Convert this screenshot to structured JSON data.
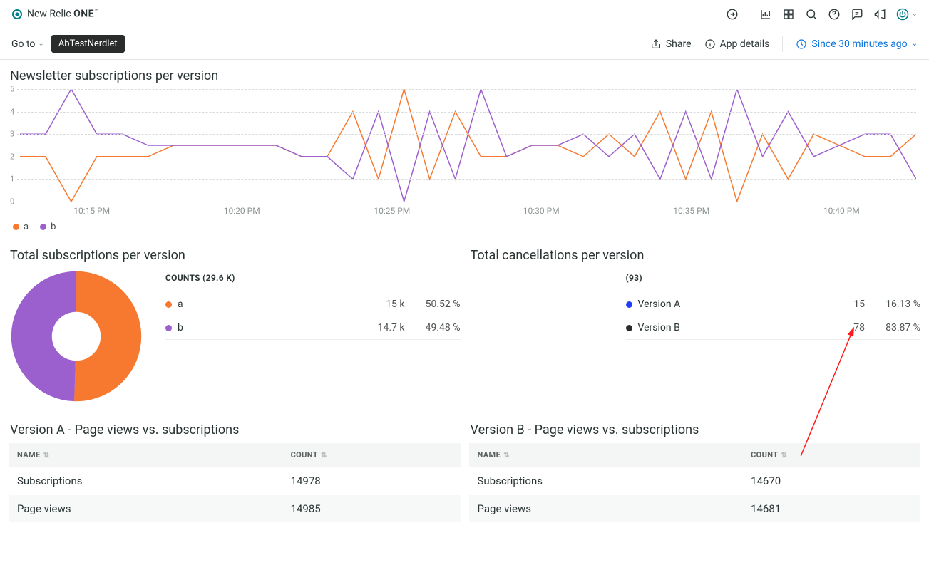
{
  "brand": {
    "name_prefix": "New Relic ",
    "name_suffix": "ONE",
    "tm": "™"
  },
  "topbar_icons": [
    "goto-icon",
    "chart-icon",
    "apps-icon",
    "search-icon",
    "help-icon",
    "feedback-icon",
    "announce-icon"
  ],
  "subbar": {
    "goto_label": "Go to",
    "badge": "AbTestNerdlet",
    "share_label": "Share",
    "app_details_label": "App details",
    "time_label": "Since 30 minutes ago"
  },
  "colors": {
    "a": "#f6792f",
    "b": "#9c5fce",
    "versionA": "#1f3fff",
    "versionB": "#2a2b2b"
  },
  "chart_data": [
    {
      "type": "line",
      "title": "Newsletter subscriptions per version",
      "ylabel": "",
      "xlabel": "",
      "ylim": [
        0,
        5
      ],
      "y_ticks": [
        0,
        1,
        2,
        3,
        4,
        5
      ],
      "x_ticks": [
        "10:15 PM",
        "10:20 PM",
        "10:25 PM",
        "10:30 PM",
        "10:35 PM",
        "10:40 PM"
      ],
      "x_tick_positions": [
        0.083,
        0.25,
        0.417,
        0.583,
        0.75,
        0.917
      ],
      "series": [
        {
          "name": "a",
          "color": "#f6792f",
          "values": [
            2,
            2,
            0,
            2,
            2,
            2,
            2.5,
            2.5,
            2.5,
            2.5,
            2.5,
            2,
            2,
            4,
            1,
            5,
            1,
            4,
            2,
            2,
            2.5,
            2.5,
            2,
            3,
            2,
            4,
            1,
            4,
            0,
            3,
            1,
            3,
            2.5,
            2,
            2,
            3
          ]
        },
        {
          "name": "b",
          "color": "#9c5fce",
          "values": [
            3,
            3,
            5,
            3,
            3,
            2.5,
            2.5,
            2.5,
            2.5,
            2.5,
            2.5,
            2,
            2,
            1,
            4,
            0,
            4,
            1,
            5,
            2,
            2.5,
            2.5,
            3,
            2,
            3,
            1,
            4,
            1,
            5,
            2,
            4,
            2,
            2.5,
            3,
            3,
            1
          ]
        }
      ],
      "legend": [
        "a",
        "b"
      ]
    },
    {
      "type": "pie",
      "title": "Total subscriptions per version",
      "counts_header": "COUNTS (29.6 K)",
      "series": [
        {
          "name": "a",
          "label": "a",
          "display_value": "15 k",
          "value": 15000,
          "pct": "50.52 %",
          "color": "#f6792f"
        },
        {
          "name": "b",
          "label": "b",
          "display_value": "14.7 k",
          "value": 14700,
          "pct": "49.48 %",
          "color": "#9c5fce"
        }
      ]
    },
    {
      "type": "table",
      "title": "Total cancellations per version",
      "counts_header": "(93)",
      "series": [
        {
          "name": "Version A",
          "value": 15,
          "pct": "16.13 %",
          "color": "#1f3fff"
        },
        {
          "name": "Version B",
          "value": 78,
          "pct": "83.87 %",
          "color": "#2a2b2b"
        }
      ]
    },
    {
      "type": "table",
      "title": "Version A - Page views vs. subscriptions",
      "columns": [
        "NAME",
        "COUNT"
      ],
      "rows": [
        {
          "name": "Subscriptions",
          "count": 14978
        },
        {
          "name": "Page views",
          "count": 14985
        }
      ]
    },
    {
      "type": "table",
      "title": "Version B - Page views vs. subscriptions",
      "columns": [
        "NAME",
        "COUNT"
      ],
      "rows": [
        {
          "name": "Subscriptions",
          "count": 14670
        },
        {
          "name": "Page views",
          "count": 14681
        }
      ]
    }
  ]
}
